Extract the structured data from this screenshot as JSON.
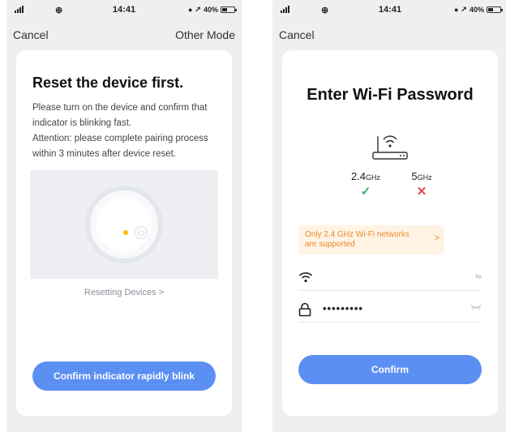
{
  "status_bar": {
    "time": "14:41",
    "battery": "40%"
  },
  "reset_screen": {
    "nav": {
      "cancel": "Cancel",
      "other_mode": "Other Mode"
    },
    "title": "Reset the device first.",
    "description_lines": [
      "Please turn on the device and confirm that",
      "indicator is blinking fast.",
      "Attention: please complete pairing process",
      "within 3 minutes after device reset."
    ],
    "link": "Resetting Devices >",
    "button": "Confirm indicator rapidly blink",
    "colors": {
      "accent": "#5b8ff2",
      "led": "#f4c20d"
    }
  },
  "wifi_screen": {
    "nav": {
      "cancel": "Cancel"
    },
    "title": "Enter Wi-Fi Password",
    "bands": [
      {
        "label": "2.4",
        "unit": "GHz",
        "supported": true,
        "mark": "✓"
      },
      {
        "label": "5",
        "unit": "GHz",
        "supported": false,
        "mark": "✕"
      }
    ],
    "notice_lines": [
      "Only 2.4 GHz Wi-Fi networks",
      "are supported"
    ],
    "notice_chevron": ">",
    "ssid_value": "",
    "password_value": "•••••••••",
    "button": "Confirm",
    "icons": {
      "router": "router-icon",
      "ssid": "wifi-icon",
      "password": "lock-icon",
      "swap": "swap-icon",
      "eye": "eye-closed-icon"
    },
    "colors": {
      "notice_bg": "#fff3e3",
      "notice_text": "#e98b2a",
      "check": "#2fb462",
      "cross": "#e04a4a"
    }
  }
}
